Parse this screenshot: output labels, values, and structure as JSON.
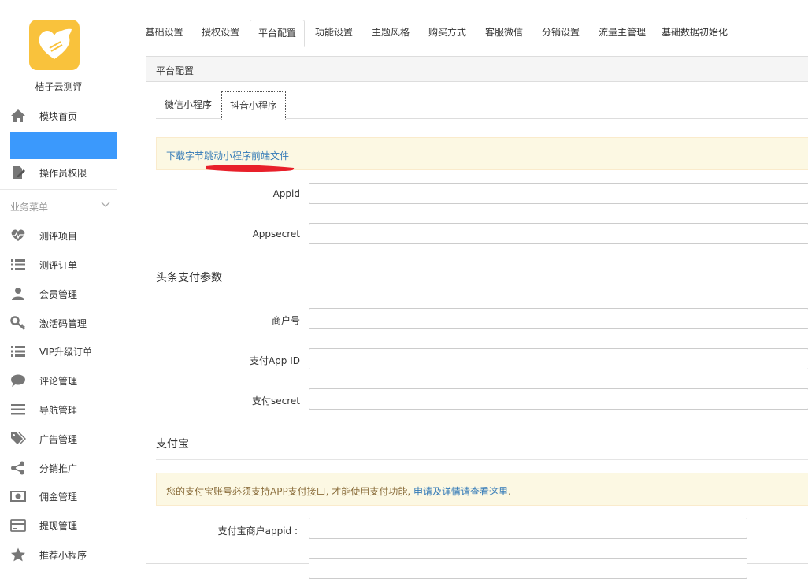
{
  "app": {
    "name": "桔子云测评"
  },
  "sidebar": {
    "items": [
      {
        "label": "模块首页",
        "icon": "home-icon"
      },
      {
        "label": "",
        "icon": ""
      },
      {
        "label": "操作员权限",
        "icon": "edit-doc-icon"
      }
    ],
    "group_title": "业务菜单",
    "group_items": [
      {
        "label": "测评项目",
        "icon": "heartbeat-icon"
      },
      {
        "label": "测评订单",
        "icon": "list-icon"
      },
      {
        "label": "会员管理",
        "icon": "user-icon"
      },
      {
        "label": "激活码管理",
        "icon": "key-icon"
      },
      {
        "label": "VIP升级订单",
        "icon": "list-icon"
      },
      {
        "label": "评论管理",
        "icon": "comment-icon"
      },
      {
        "label": "导航管理",
        "icon": "bars-icon"
      },
      {
        "label": "广告管理",
        "icon": "tags-icon"
      },
      {
        "label": "分销推广",
        "icon": "share-icon"
      },
      {
        "label": "佣金管理",
        "icon": "money-icon"
      },
      {
        "label": "提现管理",
        "icon": "credit-card-icon"
      },
      {
        "label": "推荐小程序",
        "icon": "star-icon"
      }
    ]
  },
  "tabs": [
    {
      "label": "基础设置"
    },
    {
      "label": "授权设置"
    },
    {
      "label": "平台配置"
    },
    {
      "label": "功能设置"
    },
    {
      "label": "主题风格"
    },
    {
      "label": "购买方式"
    },
    {
      "label": "客服微信"
    },
    {
      "label": "分销设置"
    },
    {
      "label": "流量主管理"
    },
    {
      "label": "基础数据初始化"
    }
  ],
  "active_tab": "平台配置",
  "panel": {
    "title": "平台配置",
    "subtabs": [
      {
        "label": "微信小程序"
      },
      {
        "label": "抖音小程序"
      }
    ],
    "active_subtab": "抖音小程序",
    "download_link": "下载字节跳动小程序前端文件",
    "fields": {
      "appid_label": "Appid",
      "appid_value": "",
      "appsecret_label": "Appsecret",
      "appsecret_value": ""
    },
    "toutiao_pay": {
      "title": "头条支付参数",
      "merchant_label": "商户号",
      "merchant_value": "",
      "pay_appid_label": "支付App ID",
      "pay_appid_value": "",
      "pay_secret_label": "支付secret",
      "pay_secret_value": ""
    },
    "alipay": {
      "title": "支付宝",
      "notice_text": "您的支付宝账号必须支持APP支付接口, 才能使用支付功能, ",
      "notice_link": "申请及详情请查看这里",
      "notice_end": ".",
      "merchant_appid_label": "支付宝商户appid :",
      "merchant_appid_value": ""
    }
  },
  "colors": {
    "active_blue": "#3b99fc",
    "logo_yellow": "#f9c23c",
    "annotation_red": "#e8202a"
  }
}
